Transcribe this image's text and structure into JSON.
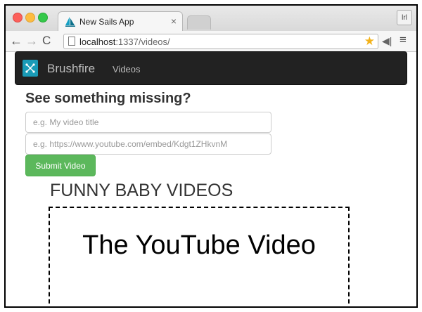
{
  "browser": {
    "tab_title": "New Sails App",
    "tab_close": "×",
    "profile_label": "lrl",
    "url_host": "localhost",
    "url_path": ":1337/videos/",
    "url_placeholder_value": "localhost:1337/videos/"
  },
  "navbar": {
    "brand": "Brushfire",
    "link": "Videos"
  },
  "form": {
    "heading": "See something missing?",
    "title_placeholder": "e.g. My video title",
    "src_placeholder": "e.g. https://www.youtube.com/embed/Kdgt1ZHkvnM",
    "submit_label": "Submit Video"
  },
  "videos": {
    "section_title": "FUNNY BABY VIDEOS",
    "placeholder_label": "The YouTube Video"
  },
  "colors": {
    "navbar_bg": "#222222",
    "submit_bg": "#5cb85c",
    "logo_bg": "#1a9bb7"
  }
}
